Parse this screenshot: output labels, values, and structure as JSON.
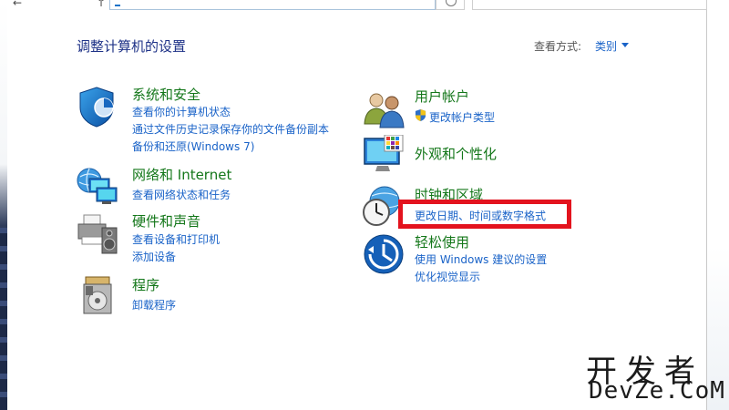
{
  "header": {
    "title": "调整计算机的设置",
    "view_by_label": "查看方式:",
    "view_by_value": "类别"
  },
  "categories": {
    "system": {
      "title": "系统和安全",
      "links": [
        "查看你的计算机状态",
        "通过文件历史记录保存你的文件备份副本",
        "备份和还原(Windows 7)"
      ]
    },
    "network": {
      "title": "网络和 Internet",
      "links": [
        "查看网络状态和任务"
      ]
    },
    "hardware": {
      "title": "硬件和声音",
      "links": [
        "查看设备和打印机",
        "添加设备"
      ]
    },
    "programs": {
      "title": "程序",
      "links": [
        "卸载程序"
      ]
    },
    "users": {
      "title": "用户帐户",
      "links": [
        "更改帐户类型"
      ]
    },
    "appearance": {
      "title": "外观和个性化",
      "links": []
    },
    "clock": {
      "title": "时钟和区域",
      "links": [
        "更改日期、时间或数字格式"
      ]
    },
    "ease": {
      "title": "轻松使用",
      "links": [
        "使用 Windows 建议的设置",
        "优化视觉显示"
      ]
    }
  },
  "watermark": {
    "line1": "开发者",
    "line2": "DevZe.CoM"
  },
  "colors": {
    "category_title": "#14771a",
    "link": "#1a63c8",
    "page_title": "#1e3287",
    "highlight_box": "#e3131e"
  }
}
